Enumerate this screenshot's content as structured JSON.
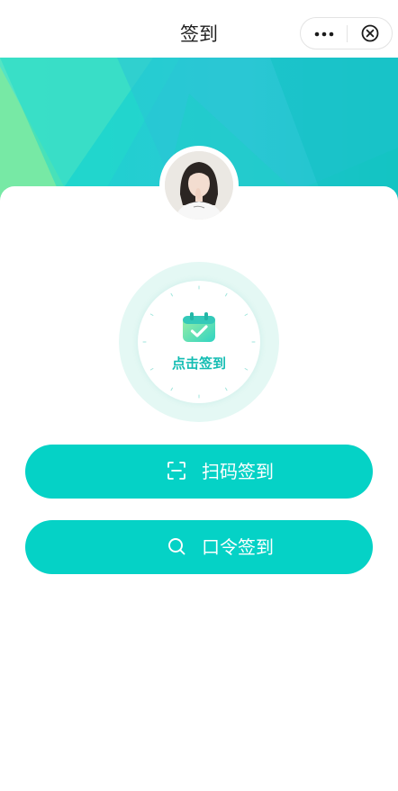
{
  "nav": {
    "title": "签到",
    "more_icon": "more-dots-icon",
    "close_icon": "close-circle-icon"
  },
  "colors": {
    "accent": "#05d2c6",
    "label": "#14bdb3",
    "ring": "#e4f8f4",
    "banner": "#1fcfc9"
  },
  "checkin": {
    "icon": "calendar-check-icon",
    "label": "点击签到"
  },
  "actions": {
    "scan": {
      "icon": "scan-icon",
      "label": "扫码签到"
    },
    "code": {
      "icon": "search-icon",
      "label": "口令签到"
    }
  }
}
